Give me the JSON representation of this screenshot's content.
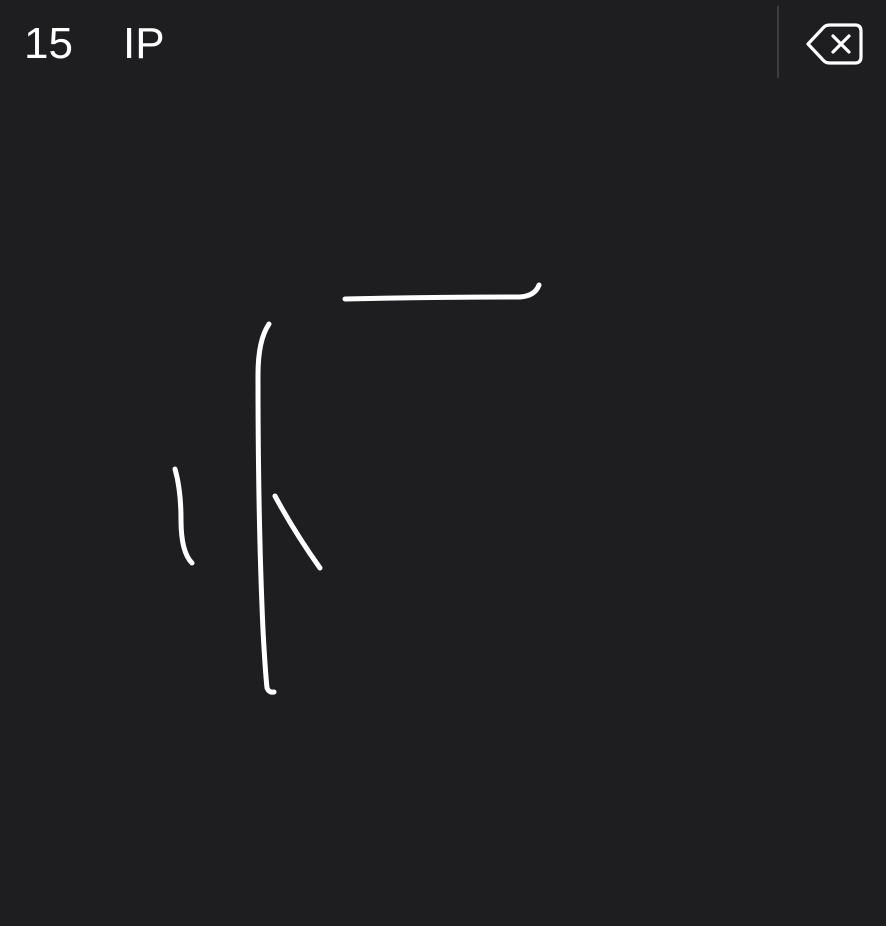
{
  "candidates": [
    {
      "label": "15"
    },
    {
      "label": "IP"
    }
  ],
  "delete_button": {
    "icon": "delete-backspace-icon"
  },
  "handwriting_canvas": {
    "stroke_color": "#ffffff",
    "background_color": "#1e1d20"
  }
}
